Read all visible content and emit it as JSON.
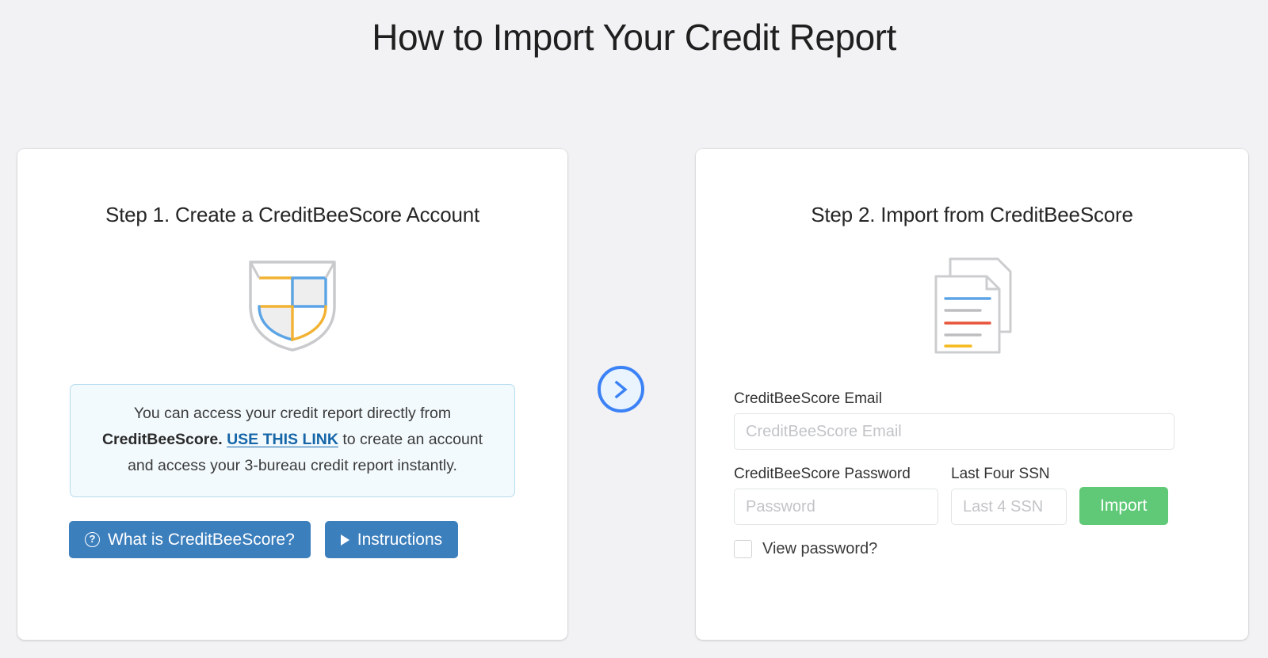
{
  "page": {
    "title": "How to Import Your Credit Report",
    "background_color": "#f2f1f4"
  },
  "colors": {
    "blue_button": "#3c7fbd",
    "green_button": "#5fc978",
    "link_blue": "#1666a8",
    "arrow_blue": "#3b82f6",
    "info_box_border": "#b6dcf0",
    "info_box_fill": "#f3fafd"
  },
  "step1": {
    "title": "Step 1. Create a CreditBeeScore Account",
    "icon": "shield-icon",
    "info": {
      "text_part1": "You can access your credit report directly from ",
      "brand": "CreditBeeScore.",
      "link": "USE THIS LINK",
      "text_part2": " to create an account and access your 3-bureau credit report instantly."
    },
    "buttons": {
      "what_is": "What is CreditBeeScore?",
      "instructions": "Instructions"
    }
  },
  "flow": {
    "arrow": "chevron-right-icon"
  },
  "step2": {
    "title": "Step 2. Import from CreditBeeScore",
    "icon": "document-icon",
    "fields": {
      "email_label": "CreditBeeScore Email",
      "email_placeholder": "CreditBeeScore Email",
      "email_value": "",
      "password_label": "CreditBeeScore Password",
      "password_placeholder": "Password",
      "password_value": "",
      "ssn_label": "Last Four SSN",
      "ssn_placeholder": "Last 4 SSN",
      "ssn_value": ""
    },
    "import_button": "Import",
    "view_password_label": "View password?",
    "view_password_checked": false
  }
}
